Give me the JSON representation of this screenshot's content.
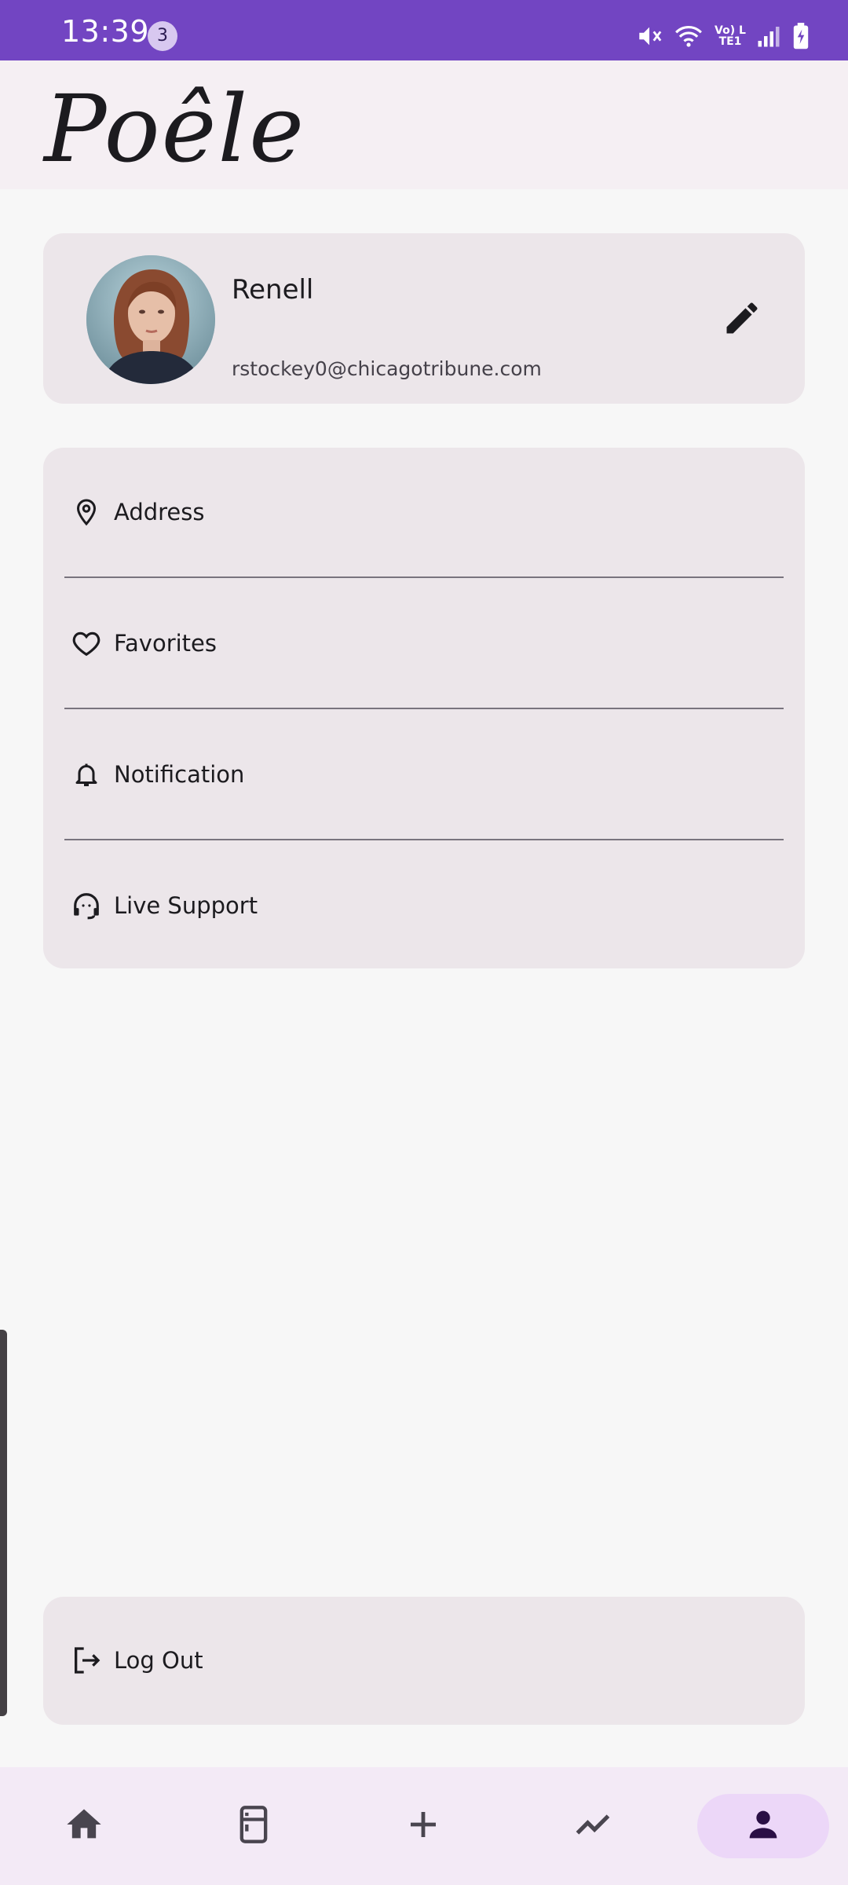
{
  "status_bar": {
    "time": "13:39",
    "notification_count": "3",
    "network_label": "Vo) LTE1"
  },
  "header": {
    "logo_text": "Poêle"
  },
  "profile": {
    "name": "Renell",
    "email": "rstockey0@chicagotribune.com",
    "edit_icon": "pencil-icon"
  },
  "menu": {
    "items": [
      {
        "label": "Address",
        "icon": "location-pin-icon"
      },
      {
        "label": "Favorites",
        "icon": "heart-icon"
      },
      {
        "label": "Notification",
        "icon": "bell-icon"
      },
      {
        "label": "Live Support",
        "icon": "headset-icon"
      }
    ]
  },
  "logout": {
    "label": "Log Out",
    "icon": "logout-icon"
  },
  "bottom_nav": {
    "items": [
      {
        "icon": "home-icon",
        "active": false
      },
      {
        "icon": "fridge-icon",
        "active": false
      },
      {
        "icon": "plus-icon",
        "active": false
      },
      {
        "icon": "trending-icon",
        "active": false
      },
      {
        "icon": "person-icon",
        "active": true
      }
    ]
  },
  "colors": {
    "status_bar": "#7245c2",
    "card_background": "#ece6ea",
    "active_nav_pill": "#ecd7f8",
    "nav_background": "#f3eaf6"
  }
}
